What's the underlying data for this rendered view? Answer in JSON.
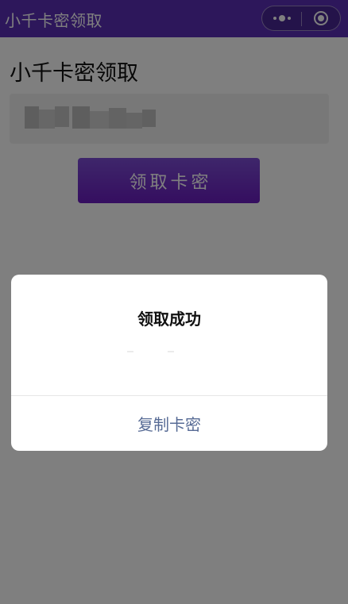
{
  "navbar": {
    "title": "小千卡密领取",
    "more_icon": "more-dots-icon",
    "close_icon": "miniprogram-close-icon",
    "background": "#5a2fb6"
  },
  "main": {
    "heading": "小千卡密领取",
    "code_value": "",
    "get_button_label": "领取卡密",
    "button_color": "#6a1cc0"
  },
  "modal": {
    "title": "领取成功",
    "content": "",
    "confirm_label": "复制卡密",
    "confirm_color": "#576b95"
  }
}
